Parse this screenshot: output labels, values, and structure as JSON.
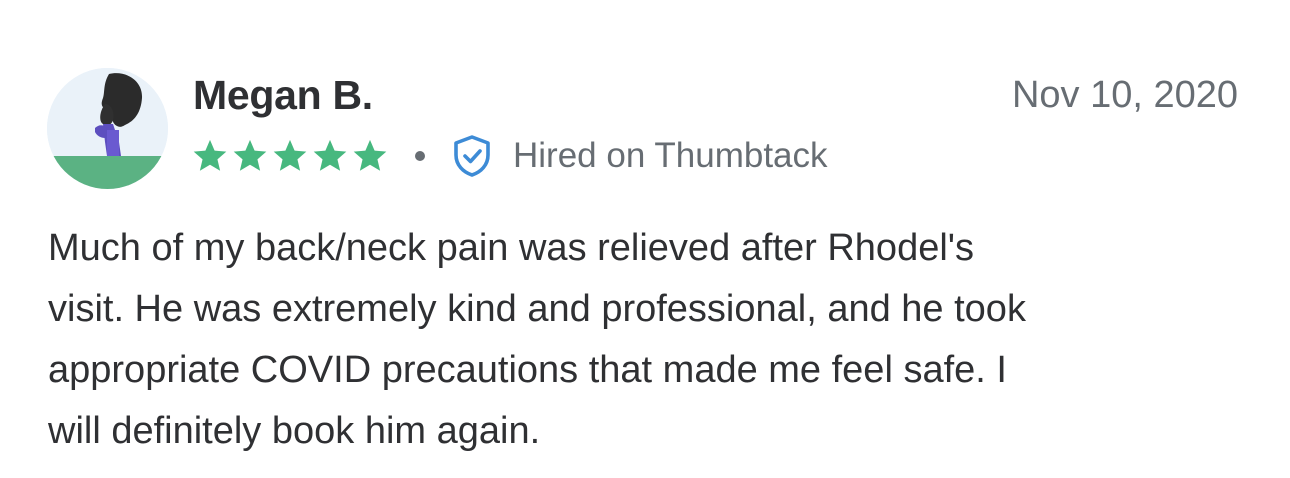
{
  "review": {
    "author": "Megan B.",
    "date": "Nov 10, 2020",
    "rating": 5,
    "rating_max": 5,
    "hired_label": "Hired on Thumbtack",
    "body_lines": [
      "Much of my back/neck pain was relieved after Rhodel's",
      "visit. He was extremely kind and professional, and he took",
      "appropriate COVID precautions that made me feel safe. I",
      "will definitely book him again."
    ]
  },
  "icons": {
    "avatar": "person-silhouette-avatar",
    "star": "star-icon",
    "badge": "shield-check-icon"
  },
  "colors": {
    "star_green": "#47b87f",
    "shield_blue": "#3d8bd6",
    "text_dark": "#2f3033",
    "text_muted": "#676d73"
  }
}
